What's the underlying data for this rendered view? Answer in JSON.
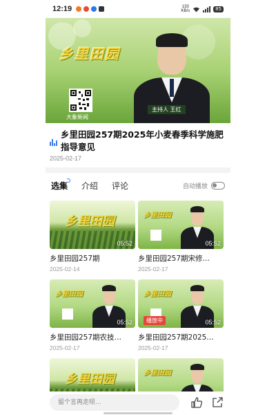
{
  "status_bar": {
    "time": "12:19",
    "speed_top": "133",
    "speed_bottom": "KB/s",
    "battery": "85"
  },
  "video": {
    "logo_text": "乡里田园",
    "qr_caption": "大象新闻",
    "anchor_tag": "主持人 王红"
  },
  "episode": {
    "title": "乡里田园257期2025年小麦春季科学施肥指导意见",
    "date": "2025-02-17"
  },
  "tabs": [
    {
      "label": "选集"
    },
    {
      "label": "介绍"
    },
    {
      "label": "评论"
    }
  ],
  "autoplay": {
    "label": "自动播放",
    "enabled": false
  },
  "episodes": [
    {
      "title": "乡里田园257期",
      "date": "2025-02-14",
      "duration": "05:52",
      "thumb": "logo-field",
      "playing": false
    },
    {
      "title": "乡里田园257期宋修…",
      "date": "2025-02-17",
      "duration": "05:52",
      "thumb": "anchor",
      "playing": false
    },
    {
      "title": "乡里田园257期农技…",
      "date": "2025-02-17",
      "duration": "05:52",
      "thumb": "anchor",
      "playing": false
    },
    {
      "title": "乡里田园257期2025…",
      "date": "2025-02-17",
      "duration": "05:52",
      "thumb": "anchor",
      "playing": true,
      "playing_label": "播放中"
    },
    {
      "title": "",
      "date": "",
      "duration": "",
      "thumb": "logo-field",
      "playing": false
    },
    {
      "title": "",
      "date": "",
      "duration": "",
      "thumb": "anchor",
      "playing": false
    }
  ],
  "bottom_bar": {
    "comment_placeholder": "留个言再走呗..."
  },
  "colors": {
    "accent": "#3b7cf0",
    "playing_badge": "#e8443a",
    "logo_yellow": "#f4d23c"
  }
}
